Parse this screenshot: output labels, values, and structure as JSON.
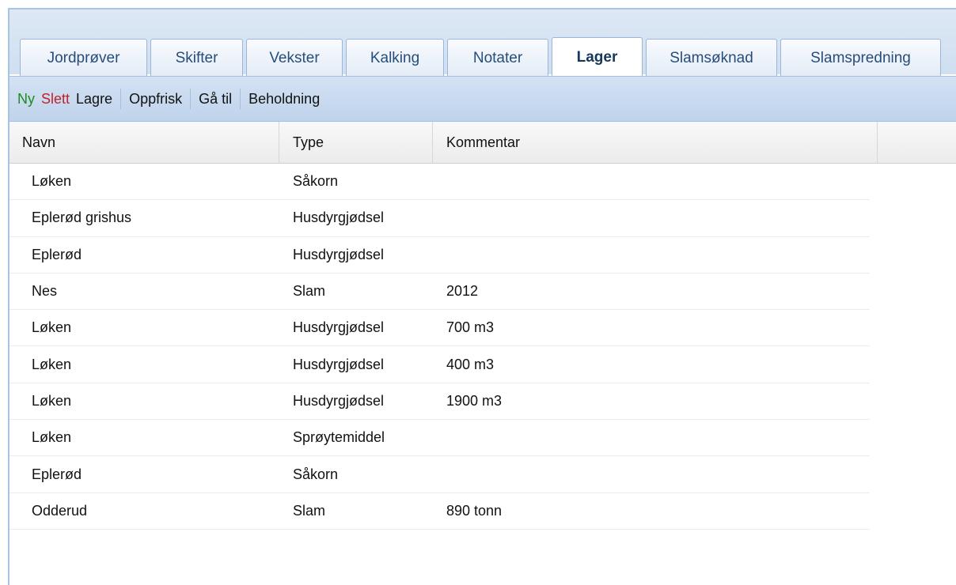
{
  "tabs": [
    {
      "label": "Jordprøver",
      "active": false
    },
    {
      "label": "Skifter",
      "active": false
    },
    {
      "label": "Vekster",
      "active": false
    },
    {
      "label": "Kalking",
      "active": false
    },
    {
      "label": "Notater",
      "active": false
    },
    {
      "label": "Lager",
      "active": true
    },
    {
      "label": "Slamsøknad",
      "active": false
    },
    {
      "label": "Slamspredning",
      "active": false
    }
  ],
  "toolbar": {
    "ny": "Ny",
    "slett": "Slett",
    "lagre": "Lagre",
    "oppfrisk": "Oppfrisk",
    "ga_til": "Gå til",
    "beholdning": "Beholdning"
  },
  "colors": {
    "ny": "#1f8a1f",
    "slett": "#c2202a",
    "tab_text": "#274d7a"
  },
  "table": {
    "headers": {
      "navn": "Navn",
      "type": "Type",
      "kommentar": "Kommentar"
    },
    "rows": [
      {
        "navn": "Løken",
        "type": "Såkorn",
        "kommentar": ""
      },
      {
        "navn": "Eplerød grishus",
        "type": "Husdyrgjødsel",
        "kommentar": ""
      },
      {
        "navn": "Eplerød",
        "type": "Husdyrgjødsel",
        "kommentar": ""
      },
      {
        "navn": "Nes",
        "type": "Slam",
        "kommentar": "2012"
      },
      {
        "navn": "Løken",
        "type": "Husdyrgjødsel",
        "kommentar": "700 m3"
      },
      {
        "navn": "Løken",
        "type": "Husdyrgjødsel",
        "kommentar": "400 m3"
      },
      {
        "navn": "Løken",
        "type": "Husdyrgjødsel",
        "kommentar": "1900 m3"
      },
      {
        "navn": "Løken",
        "type": "Sprøytemiddel",
        "kommentar": ""
      },
      {
        "navn": "Eplerød",
        "type": "Såkorn",
        "kommentar": ""
      },
      {
        "navn": "Odderud",
        "type": "Slam",
        "kommentar": "890 tonn"
      }
    ]
  }
}
